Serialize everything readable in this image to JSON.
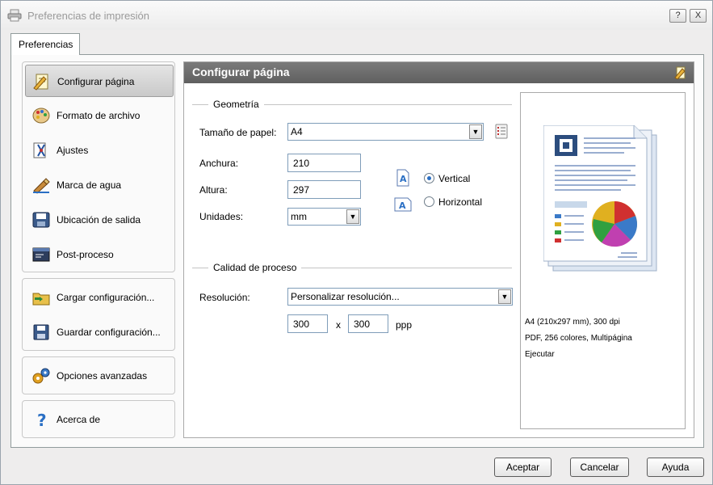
{
  "window": {
    "title": "Preferencias de impresión"
  },
  "titlebar_buttons": {
    "help": "?",
    "close": "X"
  },
  "tabs": [
    {
      "label": "Preferencias"
    }
  ],
  "sidebar": {
    "groups": [
      {
        "items": [
          {
            "label": "Configurar página",
            "icon": "page-setup-icon",
            "selected": true
          },
          {
            "label": "Formato de archivo",
            "icon": "palette-icon"
          },
          {
            "label": "Ajustes",
            "icon": "adjust-icon"
          },
          {
            "label": "Marca de agua",
            "icon": "watermark-icon"
          },
          {
            "label": "Ubicación de salida",
            "icon": "output-location-icon"
          },
          {
            "label": "Post-proceso",
            "icon": "post-process-icon"
          }
        ]
      },
      {
        "items": [
          {
            "label": "Cargar configuración...",
            "icon": "load-config-icon"
          },
          {
            "label": "Guardar configuración...",
            "icon": "save-config-icon"
          }
        ]
      },
      {
        "items": [
          {
            "label": "Opciones avanzadas",
            "icon": "advanced-gears-icon"
          }
        ]
      },
      {
        "items": [
          {
            "label": "Acerca de",
            "icon": "help-question-icon"
          }
        ]
      }
    ]
  },
  "content": {
    "header": "Configurar página",
    "geometry": {
      "section_title": "Geometría",
      "paper_size_label": "Tamaño de papel:",
      "paper_size_value": "A4",
      "width_label": "Anchura:",
      "width_value": "210",
      "height_label": "Altura:",
      "height_value": "297",
      "units_label": "Unidades:",
      "units_value": "mm",
      "orientation": {
        "vertical_label": "Vertical",
        "horizontal_label": "Horizontal",
        "selected": "vertical"
      }
    },
    "quality": {
      "section_title": "Calidad de proceso",
      "resolution_label": "Resolución:",
      "resolution_value": "Personalizar resolución...",
      "res_x": "300",
      "res_sep": "x",
      "res_y": "300",
      "res_unit": "ppp"
    },
    "preview": {
      "line1": "A4 (210x297 mm), 300 dpi",
      "line2": "PDF, 256 colores, Multipágina",
      "line3": "Ejecutar"
    }
  },
  "buttons": {
    "accept": "Aceptar",
    "cancel": "Cancelar",
    "help": "Ayuda"
  },
  "colors": {
    "header_bg": "#6d6d6d",
    "selection_bg": "#d6d6d6",
    "radio_accent": "#2a6fc4",
    "field_border": "#7f9db9"
  }
}
